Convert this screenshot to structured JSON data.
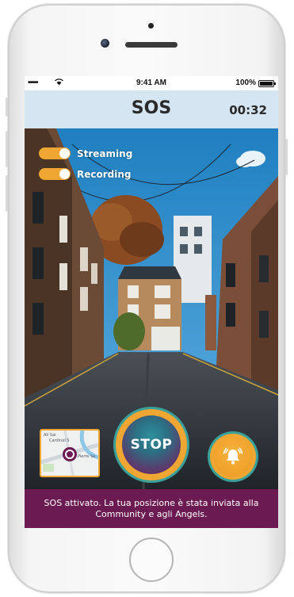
{
  "status_bar": {
    "signal": "•••••",
    "wifi_icon": "wifi-icon",
    "time": "9:41 AM",
    "battery_percent": "100%"
  },
  "header": {
    "title": "SOS",
    "timer": "00:32"
  },
  "toggles": [
    {
      "label": "Streaming",
      "on": true
    },
    {
      "label": "Recording",
      "on": true
    }
  ],
  "map": {
    "street_labels": [
      "All Sai",
      "Cardinal S",
      "Pierre Sa"
    ],
    "pin_icon": "location-pin-icon"
  },
  "stop_button": {
    "label": "STOP"
  },
  "alarm_button": {
    "icon": "bell-alarm-icon"
  },
  "banner": {
    "message": "SOS attivato. La tua posizione è stata inviata alla Community e agli Angels."
  },
  "colors": {
    "accent_orange": "#f0a632",
    "teal": "#3aa19a",
    "banner_purple": "#6b1b52",
    "header_bg": "#d5e6f2"
  }
}
